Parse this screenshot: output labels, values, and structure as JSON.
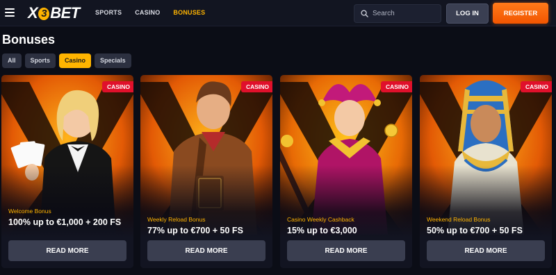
{
  "header": {
    "logo": {
      "x": "X",
      "three": "3",
      "bet": "BET"
    },
    "nav": [
      {
        "label": "SPORTS",
        "active": false
      },
      {
        "label": "CASINO",
        "active": false
      },
      {
        "label": "BONUSES",
        "active": true
      }
    ],
    "search": {
      "placeholder": "Search",
      "icon": "search-icon"
    },
    "login_label": "LOG IN",
    "register_label": "REGISTER",
    "menu_icon": "hamburger-menu-icon"
  },
  "page": {
    "title": "Bonuses",
    "filters": [
      {
        "label": "All",
        "active": false
      },
      {
        "label": "Sports",
        "active": false
      },
      {
        "label": "Casino",
        "active": true
      },
      {
        "label": "Specials",
        "active": false
      }
    ]
  },
  "cards": [
    {
      "badge": "CASINO",
      "subtitle": "Welcome Bonus",
      "headline": "100% up to €1,000 + 200 FS",
      "button": "READ MORE",
      "image": "dealer-with-cards"
    },
    {
      "badge": "CASINO",
      "subtitle": "Weekly Reload Bonus",
      "headline": "77% up to €700 + 50 FS",
      "button": "READ MORE",
      "image": "adventurer-with-book"
    },
    {
      "badge": "CASINO",
      "subtitle": "Casino Weekly Cashback",
      "headline": "15% up to €3,000",
      "button": "READ MORE",
      "image": "jester-with-coin"
    },
    {
      "badge": "CASINO",
      "subtitle": "Weekend Reload Bonus",
      "headline": "50% up to €700 + 50 FS",
      "button": "READ MORE",
      "image": "pharaoh-queen"
    }
  ],
  "colors": {
    "accent": "#ffb400",
    "register": "#f25500",
    "badge": "#e0102b",
    "background": "#0b0d16"
  }
}
